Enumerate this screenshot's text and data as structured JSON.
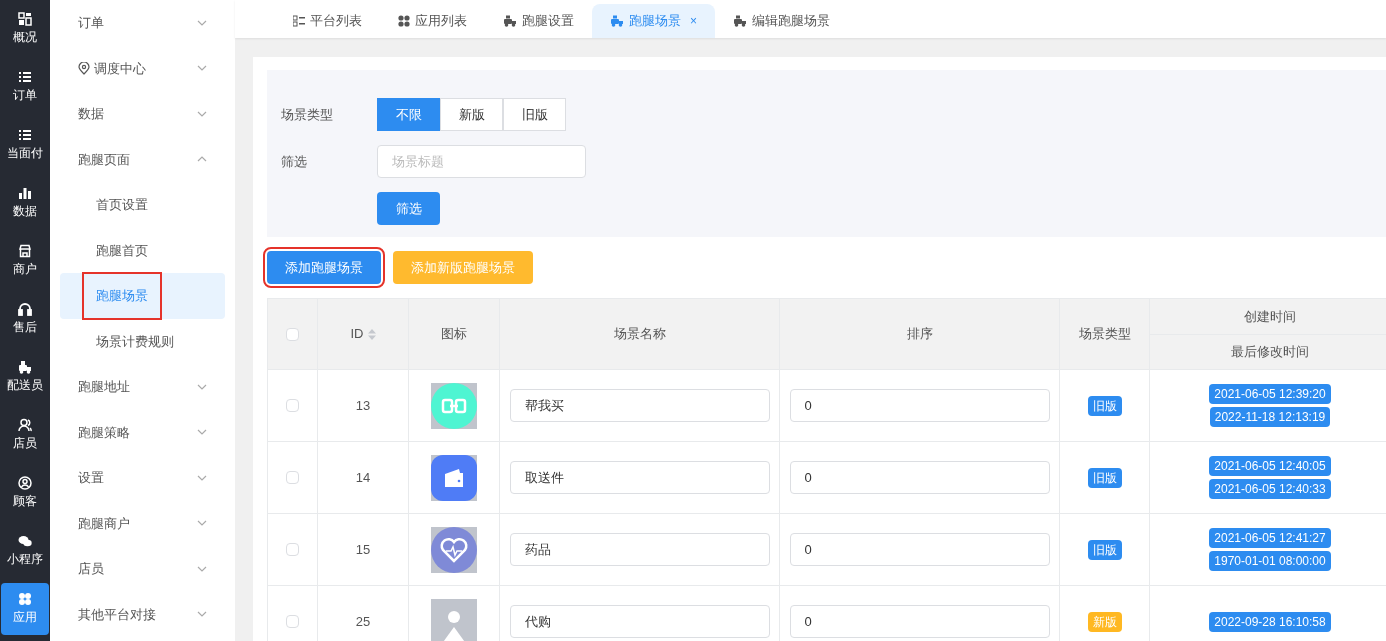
{
  "rail": [
    {
      "label": "概况",
      "selected": false
    },
    {
      "label": "订单",
      "selected": false
    },
    {
      "label": "当面付",
      "selected": false
    },
    {
      "label": "数据",
      "selected": false
    },
    {
      "label": "商户",
      "selected": false
    },
    {
      "label": "售后",
      "selected": false
    },
    {
      "label": "配送员",
      "selected": false
    },
    {
      "label": "店员",
      "selected": false
    },
    {
      "label": "顾客",
      "selected": false
    },
    {
      "label": "小程序",
      "selected": false
    },
    {
      "label": "应用",
      "selected": true
    }
  ],
  "sidebar": {
    "items": [
      {
        "label": "订单",
        "expanded": false
      },
      {
        "label": "调度中心",
        "expanded": false,
        "kind": "pin"
      },
      {
        "label": "数据",
        "expanded": false
      },
      {
        "label": "跑腿页面",
        "expanded": true,
        "children": [
          {
            "label": "首页设置",
            "selected": false,
            "highlighted": false
          },
          {
            "label": "跑腿首页",
            "selected": false,
            "highlighted": false
          },
          {
            "label": "跑腿场景",
            "selected": true,
            "highlighted": true
          },
          {
            "label": "场景计费规则",
            "selected": false,
            "highlighted": false
          }
        ]
      },
      {
        "label": "跑腿地址",
        "expanded": false
      },
      {
        "label": "跑腿策略",
        "expanded": false
      },
      {
        "label": "设置",
        "expanded": false
      },
      {
        "label": "跑腿商户",
        "expanded": false
      },
      {
        "label": "店员",
        "expanded": false
      },
      {
        "label": "其他平台对接",
        "expanded": false
      }
    ]
  },
  "tabs": [
    {
      "label": "平台列表",
      "selected": false
    },
    {
      "label": "应用列表",
      "selected": false
    },
    {
      "label": "跑腿设置",
      "selected": false
    },
    {
      "label": "跑腿场景",
      "selected": true,
      "close": "×"
    },
    {
      "label": "编辑跑腿场景",
      "selected": false
    }
  ],
  "filter": {
    "type_label": "场景类型",
    "type_options": [
      {
        "label": "不限",
        "selected": true
      },
      {
        "label": "新版",
        "selected": false
      },
      {
        "label": "旧版",
        "selected": false
      }
    ],
    "search_label": "筛选",
    "search": {
      "placeholder": "场景标题"
    },
    "submit": "筛选"
  },
  "actions": [
    {
      "label": "添加跑腿场景",
      "kind": "primary",
      "highlighted": true
    },
    {
      "label": "添加新版跑腿场景",
      "kind": "warning",
      "highlighted": false
    }
  ],
  "table": {
    "columns": [
      "ID",
      "图标",
      "场景名称",
      "排序",
      "场景类型"
    ],
    "time_header": [
      "创建时间",
      "最后修改时间"
    ],
    "all_checked": false,
    "rows": [
      {
        "checked": false,
        "id": "13",
        "name": "帮我买",
        "sort": "0",
        "type": "旧版",
        "color": "#2d8cf0",
        "times": [
          "2021-06-05 12:39:20",
          "2022-11-18 12:13:19"
        ]
      },
      {
        "checked": false,
        "id": "14",
        "name": "取送件",
        "sort": "0",
        "type": "旧版",
        "color": "#2d8cf0",
        "times": [
          "2021-06-05 12:40:05",
          "2021-06-05 12:40:33"
        ]
      },
      {
        "checked": false,
        "id": "15",
        "name": "药品",
        "sort": "0",
        "type": "旧版",
        "color": "#2d8cf0",
        "times": [
          "2021-06-05 12:41:27",
          "1970-01-01 08:00:00"
        ]
      },
      {
        "checked": false,
        "id": "25",
        "name": "代购",
        "sort": "0",
        "type": "新版",
        "color": "#ffb822",
        "times": [
          "2022-09-28 16:10:58"
        ]
      }
    ]
  }
}
